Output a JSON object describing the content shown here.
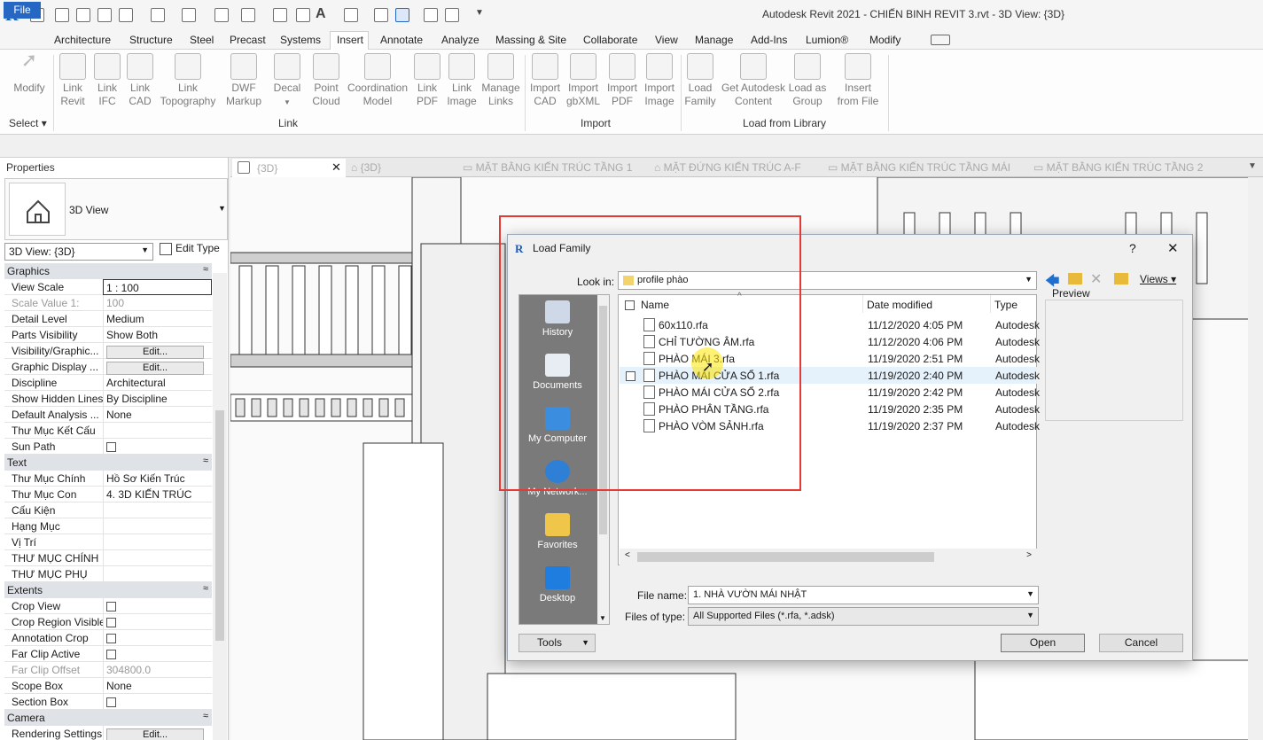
{
  "window": {
    "title": "Autodesk Revit 2021 - CHIẾN BINH REVIT 3.rvt - 3D View: {3D}",
    "app_letter": "R"
  },
  "ribbon_tabs": [
    "File",
    "Architecture",
    "Structure",
    "Steel",
    "Precast",
    "Systems",
    "Insert",
    "Annotate",
    "Analyze",
    "Massing & Site",
    "Collaborate",
    "View",
    "Manage",
    "Add-Ins",
    "Lumion®",
    "Modify"
  ],
  "ribbon_buttons": [
    {
      "l1": "Modify",
      "l2": ""
    },
    {
      "l1": "Link",
      "l2": "Revit"
    },
    {
      "l1": "Link",
      "l2": "IFC"
    },
    {
      "l1": "Link",
      "l2": "CAD"
    },
    {
      "l1": "Link",
      "l2": "Topography"
    },
    {
      "l1": "DWF",
      "l2": "Markup"
    },
    {
      "l1": "Decal",
      "l2": ""
    },
    {
      "l1": "Point",
      "l2": "Cloud"
    },
    {
      "l1": "Coordination",
      "l2": "Model"
    },
    {
      "l1": "Link",
      "l2": "PDF"
    },
    {
      "l1": "Link",
      "l2": "Image"
    },
    {
      "l1": "Manage",
      "l2": "Links"
    },
    {
      "l1": "Import",
      "l2": "CAD"
    },
    {
      "l1": "Import",
      "l2": "gbXML"
    },
    {
      "l1": "Import",
      "l2": "PDF"
    },
    {
      "l1": "Import",
      "l2": "Image"
    },
    {
      "l1": "Load",
      "l2": "Family"
    },
    {
      "l1": "Get Autodesk",
      "l2": "Content"
    },
    {
      "l1": "Load as",
      "l2": "Group"
    },
    {
      "l1": "Insert",
      "l2": "from File"
    }
  ],
  "ribbon_groups": {
    "select": "Select",
    "link": "Link",
    "import": "Import",
    "library": "Load from Library"
  },
  "properties": {
    "title": "Properties",
    "type_name": "3D View",
    "view_selector": "3D View: {3D}",
    "edit_type": "Edit Type",
    "sections": [
      {
        "name": "Graphics",
        "rows": [
          [
            "View Scale",
            "1 : 100"
          ],
          [
            "Scale Value    1:",
            "100"
          ],
          [
            "Detail Level",
            "Medium"
          ],
          [
            "Parts Visibility",
            "Show Both"
          ],
          [
            "Visibility/Graphic...",
            "Edit..."
          ],
          [
            "Graphic Display ...",
            "Edit..."
          ],
          [
            "Discipline",
            "Architectural"
          ],
          [
            "Show Hidden Lines",
            "By Discipline"
          ],
          [
            "Default Analysis ...",
            "None"
          ],
          [
            "Thư Mục Kết Cấu",
            ""
          ],
          [
            "Sun Path",
            ""
          ]
        ]
      },
      {
        "name": "Text",
        "rows": [
          [
            "Thư Mục Chính",
            "Hồ Sơ Kiến Trúc"
          ],
          [
            "Thư Mục Con",
            "4. 3D KIẾN TRÚC"
          ],
          [
            "Cấu Kiện",
            ""
          ],
          [
            "Hạng Mục",
            ""
          ],
          [
            "Vị Trí",
            ""
          ],
          [
            "THƯ MỤC CHÍNH",
            ""
          ],
          [
            "THƯ MỤC PHỤ",
            ""
          ]
        ]
      },
      {
        "name": "Extents",
        "rows": [
          [
            "Crop View",
            ""
          ],
          [
            "Crop Region Visible",
            ""
          ],
          [
            "Annotation Crop",
            ""
          ],
          [
            "Far Clip Active",
            ""
          ],
          [
            "Far Clip Offset",
            "304800.0"
          ],
          [
            "Scope Box",
            "None"
          ],
          [
            "Section Box",
            ""
          ]
        ]
      },
      {
        "name": "Camera",
        "rows": [
          [
            "Rendering Settings",
            "Edit..."
          ]
        ]
      }
    ]
  },
  "view_tabs": [
    "{3D}",
    "{3D}",
    "MẶT BẰNG KIẾN TRÚC TẦNG 1",
    "MẶT ĐỨNG KIẾN TRÚC A-F",
    "MẶT BẰNG KIẾN TRÚC TẦNG MÁI",
    "MẶT BẰNG KIẾN TRÚC TẦNG 2"
  ],
  "dialog": {
    "title": "Load Family",
    "help": "?",
    "close": "✕",
    "look_in_label": "Look in:",
    "look_in_value": "profile phào",
    "views": "Views",
    "preview": "Preview",
    "places": [
      "History",
      "Documents",
      "My Computer",
      "My Network...",
      "Favorites",
      "Desktop"
    ],
    "columns": [
      "Name",
      "Date modified",
      "Type"
    ],
    "files": [
      {
        "name": "60x110.rfa",
        "date": "11/12/2020 4:05 PM",
        "type": "Autodesk"
      },
      {
        "name": "CHỈ TƯỜNG ÂM.rfa",
        "date": "11/12/2020 4:06 PM",
        "type": "Autodesk"
      },
      {
        "name": "PHÀO MÁI 3.rfa",
        "date": "11/19/2020 2:51 PM",
        "type": "Autodesk"
      },
      {
        "name": "PHÀO MÁI CỬA SỔ 1.rfa",
        "date": "11/19/2020 2:40 PM",
        "type": "Autodesk"
      },
      {
        "name": "PHÀO MÁI CỬA SỔ 2.rfa",
        "date": "11/19/2020 2:42 PM",
        "type": "Autodesk"
      },
      {
        "name": "PHÀO PHÂN TẦNG.rfa",
        "date": "11/19/2020 2:35 PM",
        "type": "Autodesk"
      },
      {
        "name": "PHÀO VÒM SẢNH.rfa",
        "date": "11/19/2020 2:37 PM",
        "type": "Autodesk"
      }
    ],
    "file_name_label": "File name:",
    "file_name_value": "1. NHÀ VƯỜN MÁI NHẬT",
    "files_type_label": "Files of type:",
    "files_type_value": "All Supported Files  (*.rfa, *.adsk)",
    "tools": "Tools",
    "open": "Open",
    "cancel": "Cancel"
  },
  "colors": {
    "accent": "#2567c2",
    "highlight": "#e53935"
  }
}
